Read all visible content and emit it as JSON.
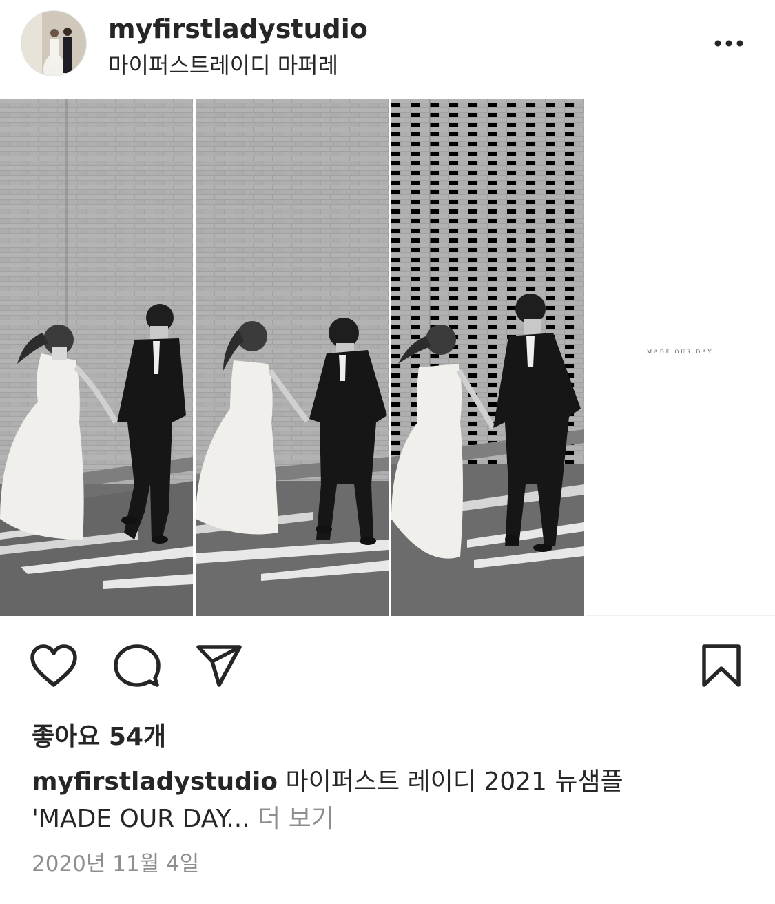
{
  "post": {
    "username": "myfirstladystudio",
    "subtitle": "마이퍼스트레이디 마퍼레",
    "image_text": "MADE OUR DAY",
    "likes_text": "좋아요 54개",
    "caption": {
      "username": "myfirstladystudio",
      "text_line1": "마이퍼스트 레이디 2021 뉴샘플",
      "text_line2": "'MADE OUR DAY...",
      "more_label": "더 보기"
    },
    "date": "2020년 11월 4일"
  },
  "icons": {
    "more": "more-options-icon",
    "like": "heart-icon",
    "comment": "comment-bubble-icon",
    "share": "paper-plane-icon",
    "save": "bookmark-icon"
  },
  "colors": {
    "text": "#262626",
    "secondary_text": "#8e8e8e",
    "background": "#ffffff"
  }
}
